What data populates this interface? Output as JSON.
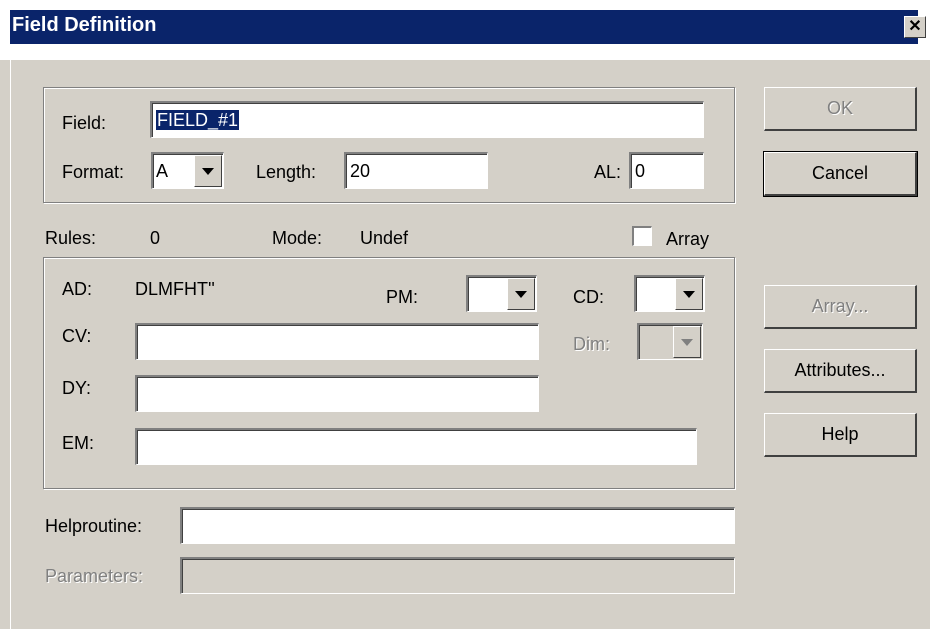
{
  "window": {
    "title": "Field Definition",
    "close_glyph": "✕"
  },
  "field": {
    "label": "Field:",
    "value": "FIELD_#1"
  },
  "format": {
    "label": "Format:",
    "value": "A"
  },
  "length": {
    "label": "Length:",
    "value": "20"
  },
  "al": {
    "label": "AL:",
    "value": "0"
  },
  "rules": {
    "label": "Rules:",
    "value": "0"
  },
  "mode": {
    "label": "Mode:",
    "value": "Undef"
  },
  "array_checkbox": {
    "label": "Array",
    "checked": false
  },
  "ad": {
    "label": "AD:",
    "value": "DLMFHT''"
  },
  "pm": {
    "label": "PM:",
    "value": ""
  },
  "cd": {
    "label": "CD:",
    "value": ""
  },
  "cv": {
    "label": "CV:",
    "value": ""
  },
  "dim": {
    "label": "Dim:",
    "value": ""
  },
  "dy": {
    "label": "DY:",
    "value": ""
  },
  "em": {
    "label": "EM:",
    "value": ""
  },
  "helproutine": {
    "label": "Helproutine:",
    "value": ""
  },
  "parameters": {
    "label": "Parameters:",
    "value": ""
  },
  "buttons": {
    "ok": "OK",
    "cancel": "Cancel",
    "array": "Array...",
    "attributes": "Attributes...",
    "help": "Help"
  },
  "colors": {
    "title_bar": "#0a246a",
    "dialog_face": "#d4d0c8",
    "selection": "#0a246a",
    "disabled_text": "#808080"
  }
}
